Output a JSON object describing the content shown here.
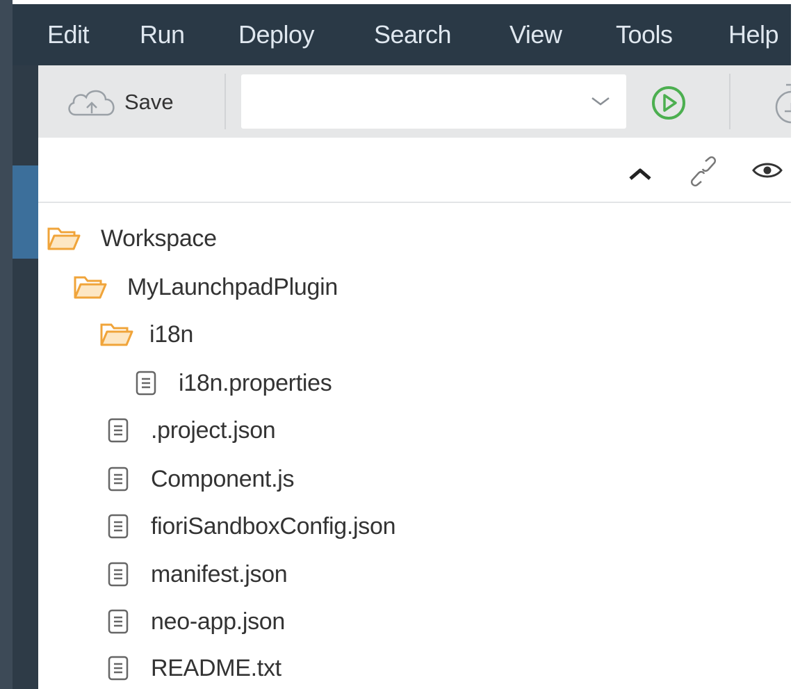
{
  "menu": {
    "items": [
      "Edit",
      "Run",
      "Deploy",
      "Search",
      "View",
      "Tools",
      "Help"
    ]
  },
  "toolbar": {
    "save_label": "Save",
    "run_config_value": ""
  },
  "tree": {
    "root": "Workspace",
    "project": "MyLaunchpadPlugin",
    "folder": "i18n",
    "folder_file": "i18n.properties",
    "files": [
      ".project.json",
      "Component.js",
      "fioriSandboxConfig.json",
      "manifest.json",
      "neo-app.json",
      "README.txt"
    ]
  },
  "colors": {
    "menubar": "#2a3946",
    "toolbar": "#e6e7e8",
    "sidebar": "#2e3b47",
    "sidebar_active": "#3c6f9b",
    "folder_orange": "#f0a43a",
    "run_green": "#4caf50"
  },
  "icons": {
    "save": "cloud-upload-icon",
    "dropdown": "chevron-down-icon",
    "run": "play-circle-icon",
    "timer": "stopwatch-icon",
    "collapse": "chevron-up-icon",
    "link": "link-icon",
    "eye": "eye-icon",
    "folder": "folder-open-icon",
    "file": "file-icon"
  }
}
